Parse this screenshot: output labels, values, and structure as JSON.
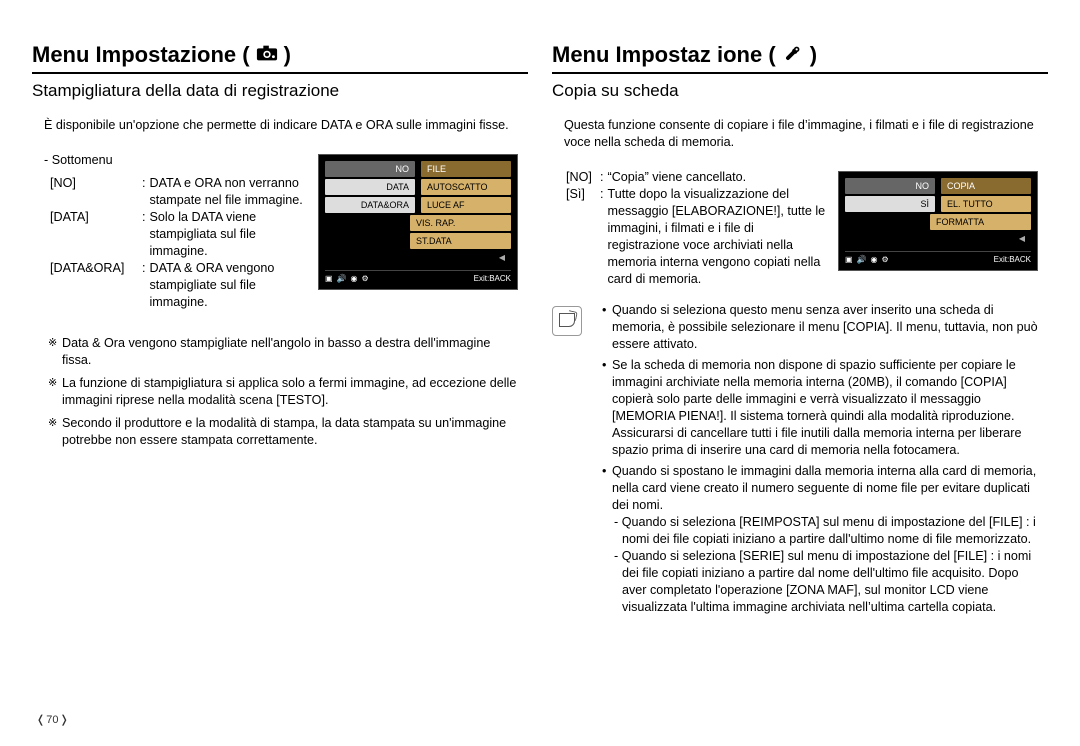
{
  "page_number": "70",
  "left": {
    "heading": "Menu Impostazione (",
    "heading_close": ")",
    "subheading": "Stampigliatura della data di registrazione",
    "intro": "È disponibile un'opzione che permette di indicare DATA e ORA sulle immagini fisse.",
    "submenu_label": "- Sottomenu",
    "defs": [
      {
        "key": "[NO]",
        "val": "DATA e ORA non verranno stampate nel file immagine."
      },
      {
        "key": "[DATA]",
        "val": "Solo la DATA viene stampigliata sul file immagine."
      },
      {
        "key": "[DATA&ORA]",
        "val": "DATA  & ORA vengono stampigliate sul file immagine."
      }
    ],
    "lcd": {
      "left_items": [
        "NO",
        "DATA",
        "DATA&ORA"
      ],
      "left_selected": 0,
      "right_items": [
        "FILE",
        "AUTOSCATTO",
        "LUCE AF",
        "VIS. RAP.",
        "ST.DATA"
      ],
      "right_selected": 0,
      "arrow": "◀",
      "footer": "Exit:BACK"
    },
    "notes": [
      "Data & Ora vengono stampigliate nell'angolo in basso a destra dell'immagine fissa.",
      "La funzione di stampigliatura si applica solo a fermi immagine, ad eccezione delle immagini riprese nella modalità scena [TESTO].",
      "Secondo il produttore e la modalità di stampa, la data stampata su un'immagine potrebbe non essere stampata correttamente."
    ]
  },
  "right": {
    "heading": "Menu Impostaz ione (",
    "heading_close": ")",
    "subheading": "Copia su scheda",
    "intro": "Questa funzione consente di copiare i file d’immagine, i filmati e i file di registrazione voce nella scheda di memoria.",
    "defs": [
      {
        "key": "[NO]",
        "val": "“Copia” viene cancellato."
      },
      {
        "key": "[Sì]",
        "val": "Tutte dopo la visualizzazione del messaggio [ELABORAZIONE!], tutte le immagini, i filmati e i file di registrazione voce archiviati nella memoria interna vengono copiati nella card di memoria."
      }
    ],
    "lcd": {
      "left_items": [
        "NO",
        "SÌ"
      ],
      "left_selected": 0,
      "right_items": [
        "COPIA",
        "EL. TUTTO",
        "FORMATTA"
      ],
      "right_selected": 0,
      "arrow": "◀",
      "footer": "Exit:BACK"
    },
    "bullets": [
      "Quando si seleziona questo menu senza aver inserito una scheda di memoria, è possibile selezionare il menu [COPIA]. Il menu, tuttavia, non può essere attivato.",
      "Se la scheda di memoria non dispone di spazio sufficiente per copiare le immagini archiviate nella memoria interna (20MB), il comando [COPIA] copierà solo parte delle immagini e verrà visualizzato il messaggio [MEMORIA PIENA!]. Il sistema tornerà quindi alla modalità riproduzione. Assicurarsi di cancellare tutti i file inutili dalla memoria interna per liberare spazio prima di inserire una card di memoria nella fotocamera.",
      "Quando si spostano le immagini dalla memoria interna alla card di memoria, nella card viene creato il numero seguente di nome file per evitare duplicati dei nomi."
    ],
    "dashes": [
      "- Quando si seleziona [REIMPOSTA] sul menu di impostazione del [FILE] : i nomi dei file copiati iniziano a partire dall'ultimo nome di file memorizzato.",
      "- Quando si seleziona [SERIE]  sul menu di impostazione del [FILE] : i nomi dei file copiati iniziano a partire dal nome dell'ultimo file acquisito. Dopo aver completato l'operazione [ZONA MAF], sul monitor LCD viene visualizzata l'ultima immagine archiviata nell’ultima cartella copiata."
    ]
  }
}
